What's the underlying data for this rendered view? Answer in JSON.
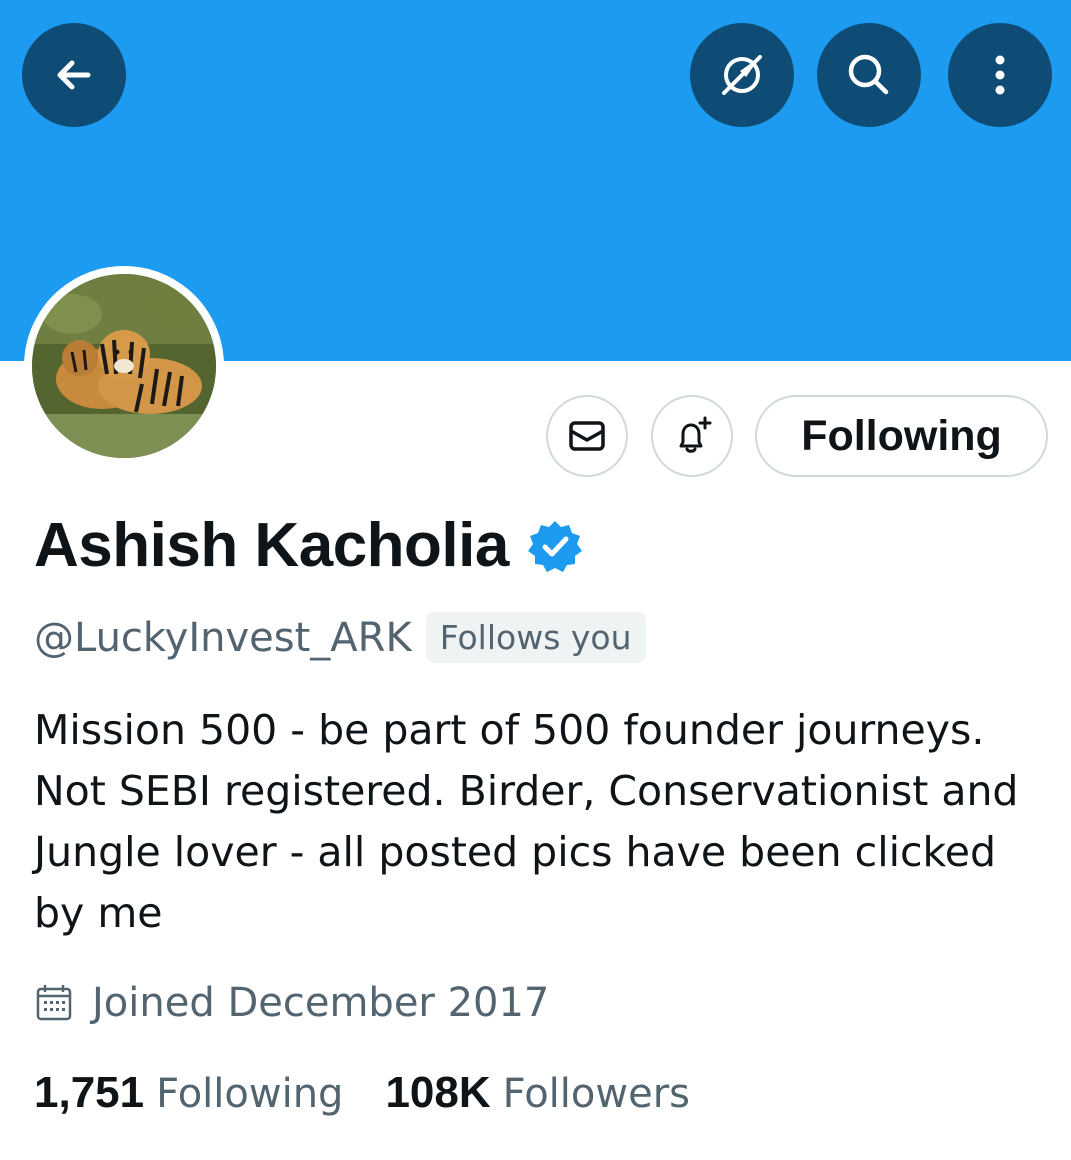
{
  "header": {
    "back_icon": "arrow-left-icon",
    "explore_icon": "compass-slash-icon",
    "search_icon": "search-icon",
    "more_icon": "more-vertical-icon",
    "banner_color": "#1d9bf0",
    "button_color": "#0f4c75"
  },
  "profile": {
    "display_name": "Ashish Kacholia",
    "verified": true,
    "verified_color": "#1d9bf0",
    "handle": "@LuckyInvest_ARK",
    "follows_you_label": "Follows you",
    "bio": "Mission 500 - be part of 500 founder journeys. Not SEBI registered. Birder, Conservationist and Jungle lover - all posted pics have been clicked by me",
    "joined": "Joined December 2017"
  },
  "actions": {
    "message_icon": "envelope-icon",
    "notify_icon": "bell-plus-icon",
    "following_label": "Following"
  },
  "stats": {
    "following_count": "1,751",
    "following_label": "Following",
    "followers_count": "108K",
    "followers_label": "Followers"
  }
}
